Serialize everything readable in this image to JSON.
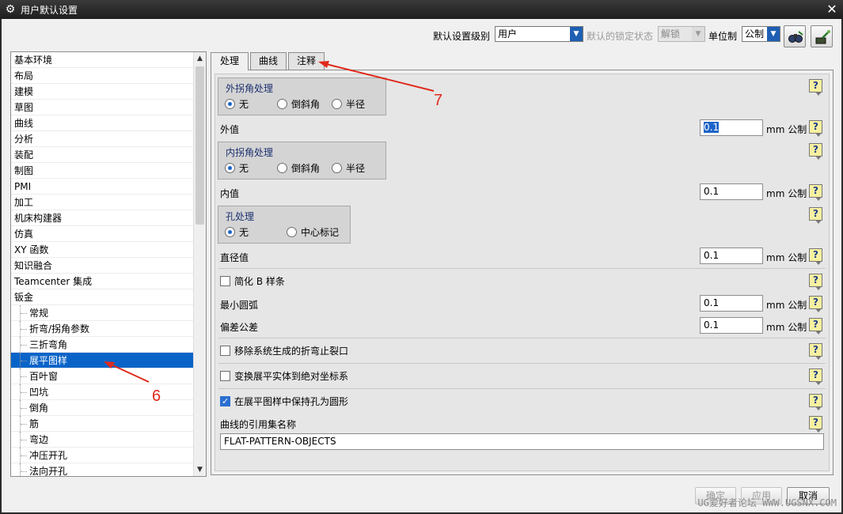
{
  "window": {
    "title": "用户默认设置",
    "close_glyph": "✕"
  },
  "toolbar": {
    "level_label": "默认设置级别",
    "level_value": "用户",
    "lock_label": "默认的锁定状态",
    "lock_value": "解锁",
    "unit_label": "单位制",
    "unit_value": "公制"
  },
  "tree": {
    "items": [
      {
        "label": "基本环境",
        "level": 0
      },
      {
        "label": "布局",
        "level": 0
      },
      {
        "label": "建模",
        "level": 0
      },
      {
        "label": "草图",
        "level": 0
      },
      {
        "label": "曲线",
        "level": 0
      },
      {
        "label": "分析",
        "level": 0
      },
      {
        "label": "装配",
        "level": 0
      },
      {
        "label": "制图",
        "level": 0
      },
      {
        "label": "PMI",
        "level": 0
      },
      {
        "label": "加工",
        "level": 0
      },
      {
        "label": "机床构建器",
        "level": 0
      },
      {
        "label": "仿真",
        "level": 0
      },
      {
        "label": "XY 函数",
        "level": 0
      },
      {
        "label": "知识融合",
        "level": 0
      },
      {
        "label": "Teamcenter 集成",
        "level": 0
      },
      {
        "label": "钣金",
        "level": 0
      },
      {
        "label": "常规",
        "level": 1
      },
      {
        "label": "折弯/拐角参数",
        "level": 1
      },
      {
        "label": "三折弯角",
        "level": 1
      },
      {
        "label": "展平图样",
        "level": 1,
        "selected": true
      },
      {
        "label": "百叶窗",
        "level": 1
      },
      {
        "label": "凹坑",
        "level": 1
      },
      {
        "label": "倒角",
        "level": 1
      },
      {
        "label": "筋",
        "level": 1
      },
      {
        "label": "弯边",
        "level": 1
      },
      {
        "label": "冲压开孔",
        "level": 1
      },
      {
        "label": "法向开孔",
        "level": 1
      }
    ]
  },
  "tabs": [
    {
      "label": "处理",
      "active": true
    },
    {
      "label": "曲线",
      "active": false
    },
    {
      "label": "注释",
      "active": false
    }
  ],
  "panel": {
    "outer_corner": {
      "title": "外拐角处理",
      "options": [
        "无",
        "倒斜角",
        "半径"
      ],
      "selected": "无"
    },
    "outer_value": {
      "label": "外值",
      "value": "0.1",
      "unit": "mm 公制"
    },
    "inner_corner": {
      "title": "内拐角处理",
      "options": [
        "无",
        "倒斜角",
        "半径"
      ],
      "selected": "无"
    },
    "inner_value": {
      "label": "内值",
      "value": "0.1",
      "unit": "mm 公制"
    },
    "hole": {
      "title": "孔处理",
      "options": [
        "无",
        "中心标记"
      ],
      "selected": "无"
    },
    "diameter_value": {
      "label": "直径值",
      "value": "0.1",
      "unit": "mm 公制"
    },
    "simplify_bspline": {
      "label": "简化 B 样条",
      "checked": false
    },
    "min_arc": {
      "label": "最小圆弧",
      "value": "0.1",
      "unit": "mm 公制"
    },
    "deviation": {
      "label": "偏差公差",
      "value": "0.1",
      "unit": "mm 公制"
    },
    "remove_relief": {
      "label": "移除系统生成的折弯止裂口",
      "checked": false
    },
    "transform_abs": {
      "label": "变换展平实体到绝对坐标系",
      "checked": false
    },
    "keep_holes": {
      "label": "在展平图样中保持孔为圆形",
      "checked": true
    },
    "refset": {
      "label": "曲线的引用集名称",
      "value": "FLAT-PATTERN-OBJECTS"
    },
    "help_glyph": "?"
  },
  "buttons": {
    "ok": "确定",
    "apply": "应用",
    "cancel": "取消"
  },
  "annotations": {
    "arrow6": "6",
    "arrow7": "7"
  },
  "watermark": "UG爱好者论坛 WWW.UGSNX.COM",
  "colors": {
    "accent": "#0a64c8",
    "annotation": "#e02a1c"
  }
}
